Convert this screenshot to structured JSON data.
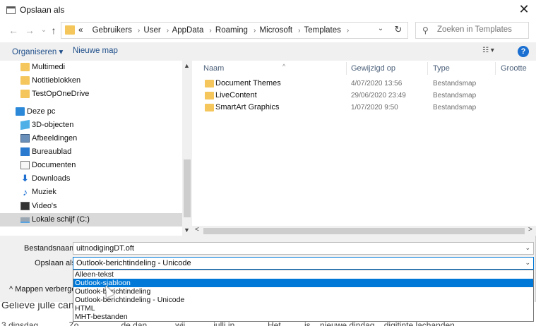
{
  "background": {
    "line1": "Gelieve julle can",
    "line2": "3 dinsdag _ ____ Zo ________ de dan _____ wij _____ julli in ______ Het ____ is _ nieuwe dindag _ digitinte lachanden"
  },
  "titlebar": {
    "title": "Opslaan als",
    "close": "✕"
  },
  "address": {
    "back": "←",
    "forward": "→",
    "history": "⌄",
    "up": "↑",
    "overflow": "«",
    "crumbs": [
      "Gebruikers",
      "User",
      "AppData",
      "Roaming",
      "Microsoft",
      "Templates"
    ],
    "dropdown": "⌄",
    "refresh": "↻"
  },
  "search": {
    "placeholder": "Zoeken in Templates"
  },
  "toolbar": {
    "organize": "Organiseren ▾",
    "new_folder": "Nieuwe map",
    "view": "☷ ▾",
    "help": "?"
  },
  "nav": {
    "items": [
      {
        "label": "Multimedi",
        "icon": "folder-icon"
      },
      {
        "label": "Notitieblokken",
        "icon": "folder-icon"
      },
      {
        "label": "TestOpOneDrive",
        "icon": "folder-icon"
      },
      {
        "label": "Deze pc",
        "icon": "pc-icon"
      },
      {
        "label": "3D-objecten",
        "icon": "cube-icon"
      },
      {
        "label": "Afbeeldingen",
        "icon": "pictures-icon"
      },
      {
        "label": "Bureaublad",
        "icon": "desktop-icon"
      },
      {
        "label": "Documenten",
        "icon": "documents-icon"
      },
      {
        "label": "Downloads",
        "icon": "download-arrow-icon"
      },
      {
        "label": "Muziek",
        "icon": "music-note-icon"
      },
      {
        "label": "Video's",
        "icon": "video-icon"
      },
      {
        "label": "Lokale schijf (C:)",
        "icon": "drive-icon"
      }
    ],
    "scroll_up": "▲",
    "scroll_down": "▼"
  },
  "files": {
    "columns": [
      "Naam",
      "Gewijzigd op",
      "Type",
      "Grootte"
    ],
    "sort_caret": "^",
    "rows": [
      {
        "name": "Document Themes",
        "modified": "4/07/2020 13:56",
        "type": "Bestandsmap"
      },
      {
        "name": "LiveContent",
        "modified": "29/06/2020 23:49",
        "type": "Bestandsmap"
      },
      {
        "name": "SmartArt Graphics",
        "modified": "1/07/2020 9:50",
        "type": "Bestandsmap"
      }
    ],
    "hscroll_left": "<",
    "hscroll_right": ">"
  },
  "form": {
    "filename_label": "Bestandsnaam:",
    "filename_value": "uitnodigingDT.oft",
    "savetype_label": "Opslaan als:",
    "savetype_value": "Outlook-berichtindeling - Unicode",
    "caret": "⌄",
    "hide_folders": "^  Mappen verberge"
  },
  "savetype_options": [
    "Alleen-tekst",
    "Outlook-sjabloon",
    "Outlook-berichtindeling",
    "Outlook-berichtindeling - Unicode",
    "HTML",
    "MHT-bestanden"
  ],
  "savetype_selected_index": 1,
  "colors": {
    "accent": "#0078d7",
    "folder": "#f4c65b",
    "link": "#1f4f8a"
  }
}
